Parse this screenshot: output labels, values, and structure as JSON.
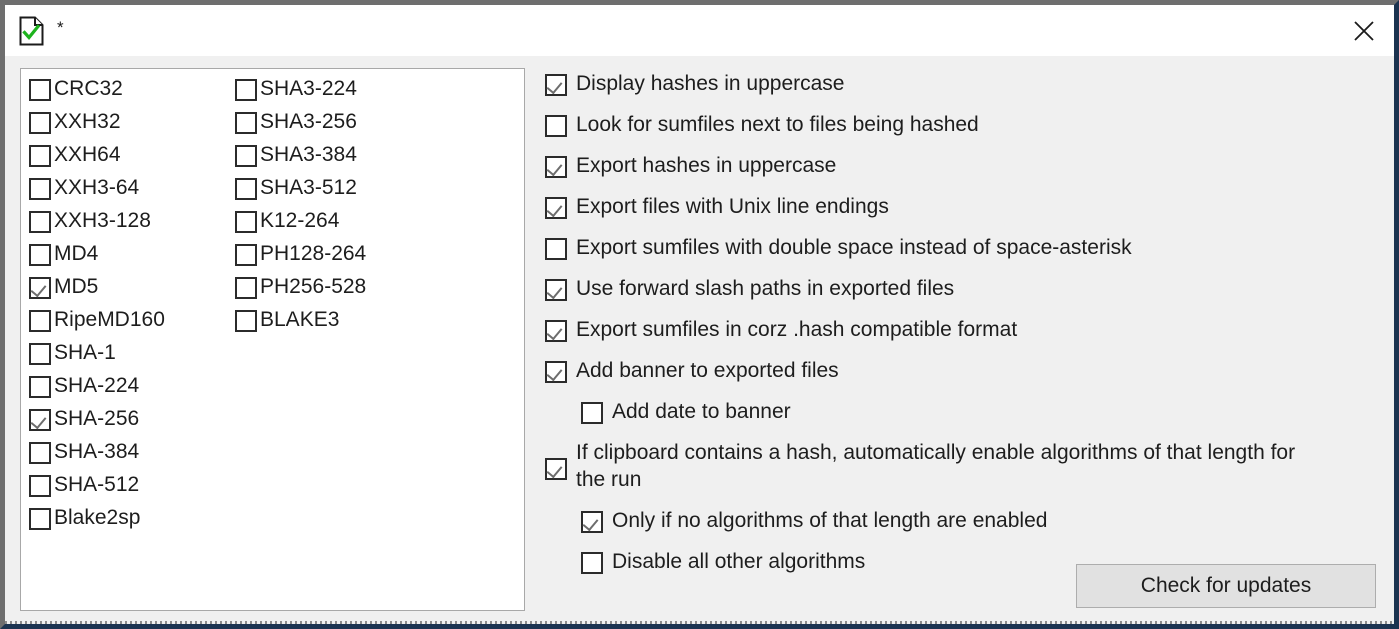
{
  "window": {
    "title": "*",
    "icon": "document-check-icon",
    "close_label": "✕",
    "border_active_color": "#1b3350",
    "border_inactive_color": "#6e6e6e",
    "client_bg": "#f0f0f0"
  },
  "algorithms": {
    "column1": [
      {
        "label": "CRC32",
        "checked": false
      },
      {
        "label": "XXH32",
        "checked": false
      },
      {
        "label": "XXH64",
        "checked": false
      },
      {
        "label": "XXH3-64",
        "checked": false
      },
      {
        "label": "XXH3-128",
        "checked": false
      },
      {
        "label": "MD4",
        "checked": false
      },
      {
        "label": "MD5",
        "checked": true
      },
      {
        "label": "RipeMD160",
        "checked": false
      },
      {
        "label": "SHA-1",
        "checked": false
      },
      {
        "label": "SHA-224",
        "checked": false
      },
      {
        "label": "SHA-256",
        "checked": true
      },
      {
        "label": "SHA-384",
        "checked": false
      },
      {
        "label": "SHA-512",
        "checked": false
      },
      {
        "label": "Blake2sp",
        "checked": false
      }
    ],
    "column2": [
      {
        "label": "SHA3-224",
        "checked": false
      },
      {
        "label": "SHA3-256",
        "checked": false
      },
      {
        "label": "SHA3-384",
        "checked": false
      },
      {
        "label": "SHA3-512",
        "checked": false
      },
      {
        "label": "K12-264",
        "checked": false
      },
      {
        "label": "PH128-264",
        "checked": false
      },
      {
        "label": "PH256-528",
        "checked": false
      },
      {
        "label": "BLAKE3",
        "checked": false
      }
    ]
  },
  "options": [
    {
      "label": "Display hashes in uppercase",
      "checked": true,
      "indent": false
    },
    {
      "label": "Look for sumfiles next to files being hashed",
      "checked": false,
      "indent": false
    },
    {
      "label": "Export hashes in uppercase",
      "checked": true,
      "indent": false
    },
    {
      "label": "Export files with Unix line endings",
      "checked": true,
      "indent": false
    },
    {
      "label": "Export sumfiles with double space instead of space-asterisk",
      "checked": false,
      "indent": false
    },
    {
      "label": "Use forward slash paths in exported files",
      "checked": true,
      "indent": false
    },
    {
      "label": "Export sumfiles in corz .hash compatible format",
      "checked": true,
      "indent": false
    },
    {
      "label": "Add banner to exported files",
      "checked": true,
      "indent": false
    },
    {
      "label": "Add date to banner",
      "checked": false,
      "indent": true
    },
    {
      "label": "If clipboard contains a hash, automatically enable algorithms of that length for the run",
      "checked": true,
      "indent": false,
      "wrap": true
    },
    {
      "label": "Only if no algorithms of that length are enabled",
      "checked": true,
      "indent": true
    },
    {
      "label": "Disable all other algorithms",
      "checked": false,
      "indent": true
    }
  ],
  "buttons": {
    "check_for_updates": "Check for updates"
  }
}
